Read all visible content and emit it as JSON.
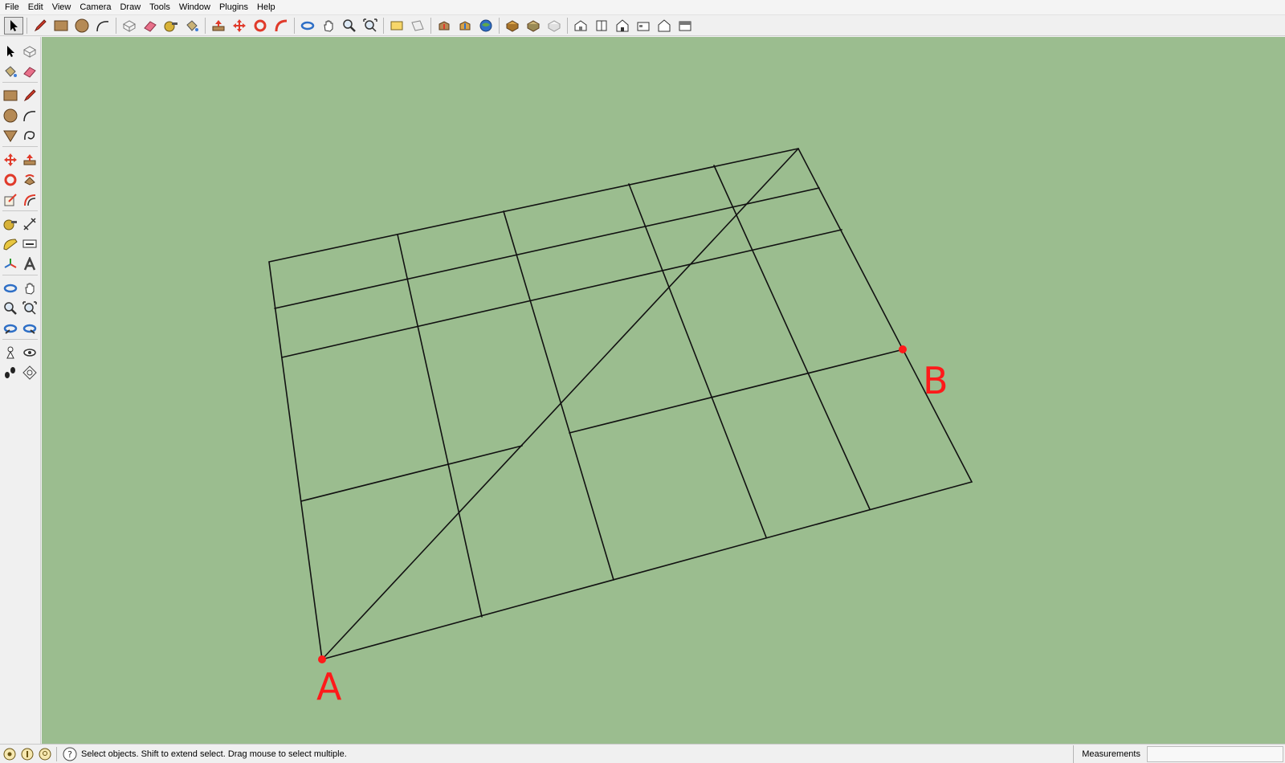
{
  "menu": {
    "items": [
      "File",
      "Edit",
      "View",
      "Camera",
      "Draw",
      "Tools",
      "Window",
      "Plugins",
      "Help"
    ]
  },
  "toolbar_top": {
    "buttons": [
      "select-icon",
      "pencil-icon",
      "rectangle-icon",
      "circle-icon",
      "arc-icon",
      "make-component-icon",
      "eraser-icon",
      "tape-measure-icon",
      "paint-bucket-icon",
      "push-pull-icon",
      "move-icon",
      "rotate-icon",
      "follow-me-icon",
      "orbit-icon",
      "pan-icon",
      "zoom-icon",
      "zoom-extents-icon",
      "previous-view-icon",
      "next-view-icon",
      "get-models-icon",
      "share-model-icon",
      "google-earth-icon",
      "components-icon",
      "materials-icon",
      "styles-icon",
      "iso-view-icon",
      "top-view-icon",
      "front-view-icon",
      "right-view-icon",
      "back-view-icon",
      "left-view-icon"
    ]
  },
  "toolbar_left": {
    "buttons": [
      "select-icon",
      "make-component-icon",
      "paint-bucket-icon",
      "eraser-icon",
      "rectangle-icon",
      "pencil-icon",
      "circle-icon",
      "arc-icon",
      "polygon-icon",
      "freehand-icon",
      "move-icon",
      "push-pull-icon",
      "rotate-icon",
      "follow-me-icon",
      "scale-icon",
      "offset-icon",
      "tape-measure-icon",
      "dimension-icon",
      "protractor-icon",
      "text-icon",
      "axes-icon",
      "3d-text-icon",
      "orbit-icon",
      "pan-icon",
      "zoom-icon",
      "zoom-window-icon",
      "previous-icon",
      "next-icon",
      "position-camera-icon",
      "look-around-icon",
      "walk-icon",
      "section-plane-icon"
    ]
  },
  "viewport": {
    "background": "#9bbd8f",
    "line_color": "#111111",
    "point_color": "#ff1a1a",
    "label_a": "A",
    "label_b": "B"
  },
  "statusbar": {
    "hint": "Select objects. Shift to extend select. Drag mouse to select multiple.",
    "measurements_label": "Measurements",
    "measurements_value": ""
  }
}
